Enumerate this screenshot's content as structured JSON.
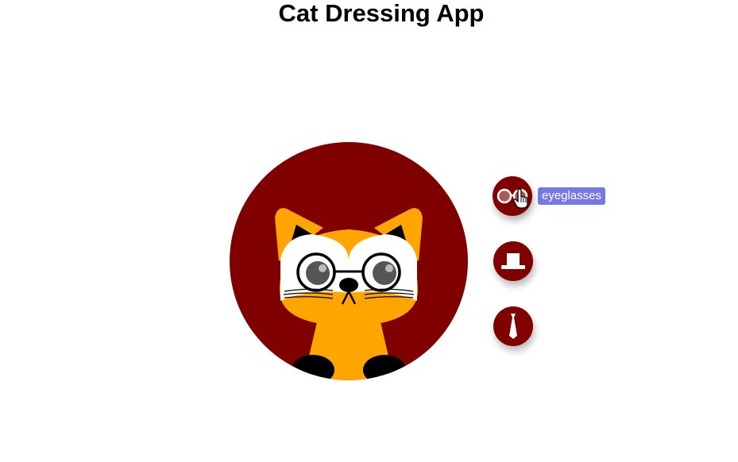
{
  "app": {
    "title": "Cat Dressing App"
  },
  "colors": {
    "background": "#ffffff",
    "circle": "#800000",
    "cat_fur": "#ffa500",
    "face_white": "#ffffff",
    "tooltip_bg": "#7777e8"
  },
  "accessories": [
    {
      "id": "eyeglasses",
      "icon": "eyeglasses-icon",
      "label": "eyeglasses",
      "applied": true
    },
    {
      "id": "hat",
      "icon": "top-hat-icon",
      "label": "hat",
      "applied": false
    },
    {
      "id": "tie",
      "icon": "necktie-icon",
      "label": "tie",
      "applied": false
    }
  ],
  "tooltip": {
    "text": "eyeglasses"
  },
  "cursor": {
    "icon": "pointer-hand-icon"
  }
}
